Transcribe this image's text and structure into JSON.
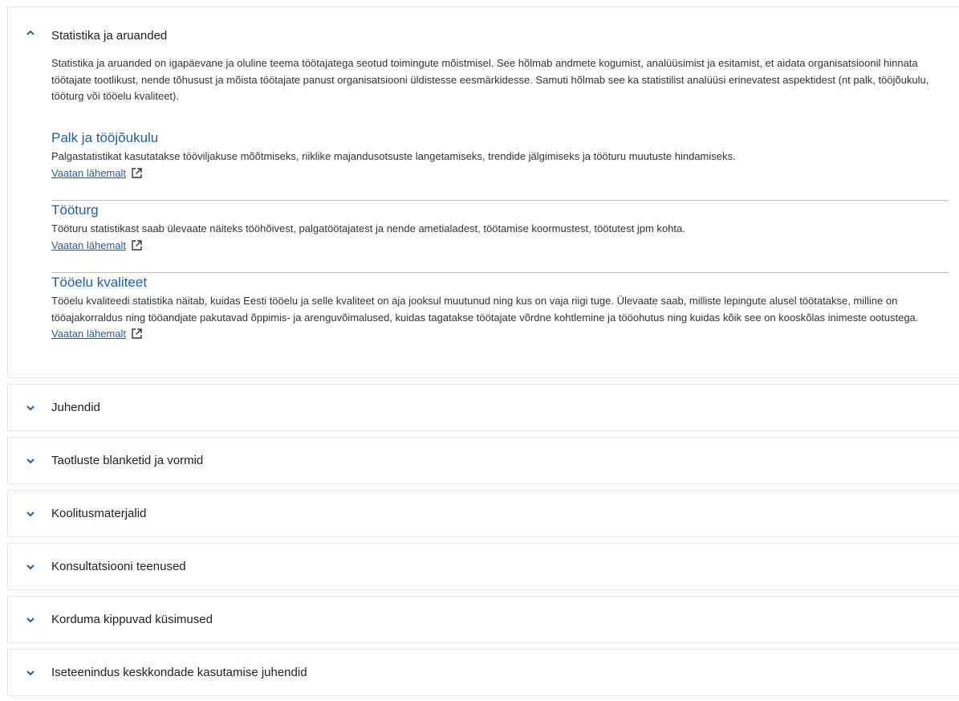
{
  "accordion": {
    "open_panel": {
      "title": "Statistika ja aruanded",
      "intro": "Statistika ja aruanded on igapäevane ja oluline teema töötajatega seotud toimingute mõistmisel. See hõlmab andmete kogumist, analüüsimist ja esitamist, et aidata organisatsioonil hinnata töötajate tootlikust, nende tõhusust ja mõista töötajate panust organisatsiooni üldistesse eesmärkidesse. Samuti hõlmab see ka statistilist analüüsi erinevatest aspektidest (nt palk, tööjõukulu, tööturg või tööelu kvaliteet).",
      "sections": [
        {
          "title": "Palk ja tööjõukulu",
          "text": "Palgastatistikat kasutatakse tööviljakuse mõõtmiseks, riiklike majandusotsuste langetamiseks, trendide jälgimiseks ja tööturu muutuste hindamiseks.",
          "link": "Vaatan lähemalt"
        },
        {
          "title": "Tööturg",
          "text": "Tööturu statistikast saab ülevaate näiteks tööhõivest, palgatöötajatest ja nende ametialadest, töötamise koormustest, töötutest jpm kohta.",
          "link": "Vaatan lähemalt"
        },
        {
          "title": "Tööelu kvaliteet",
          "text": "Tööelu kvaliteedi statistika näitab, kuidas Eesti tööelu ja selle kvaliteet on aja jooksul muutunud ning kus on vaja riigi tuge. Ülevaate saab, milliste lepingute alusel töötatakse, milline on tööajakorraldus ning tööandjate pakutavad õppimis- ja arenguvõimalused, kuidas tagatakse töötajate võrdne kohtlemine ja tööohutus ning kuidas kõik see on kooskõlas inimeste ootustega.",
          "link": "Vaatan lähemalt"
        }
      ]
    },
    "collapsed_panels": [
      "Juhendid",
      "Taotluste blanketid ja vormid",
      "Koolitusmaterjalid",
      "Konsultatsiooni teenused",
      "Korduma kippuvad küsimused",
      "Iseteenindus keskkondade kasutamise juhendid"
    ],
    "colors": {
      "accent": "#1f5fa8",
      "border": "#e3e3e3",
      "divider": "#a9c3dc",
      "chevron": "#1f5fa8"
    },
    "icons": {
      "expanded": "chevron-up-icon",
      "collapsed": "chevron-down-icon",
      "link": "external-link-icon"
    }
  }
}
